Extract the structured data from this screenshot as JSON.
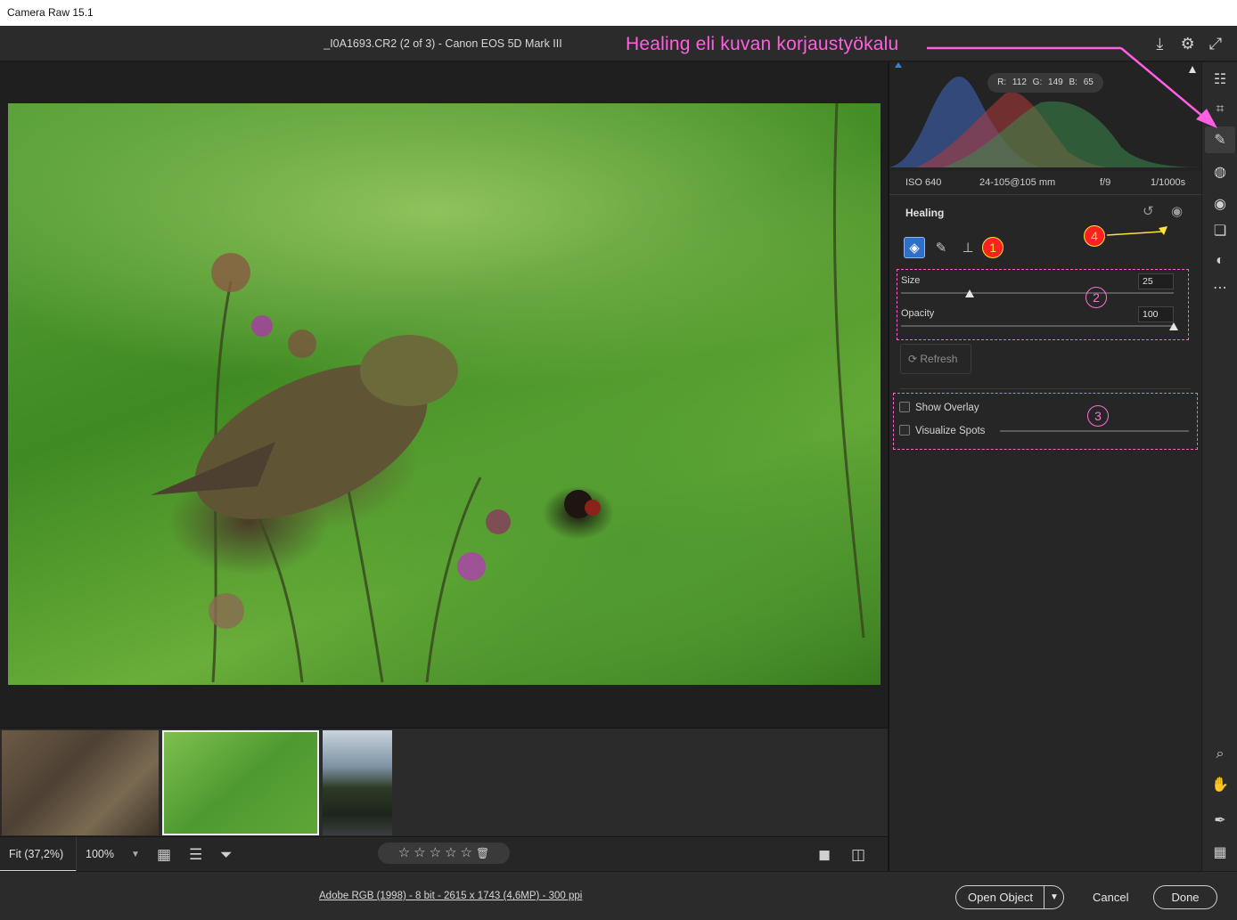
{
  "window": {
    "title": "Camera Raw 15.1"
  },
  "header": {
    "filename": "_I0A1693.CR2 (2 of 3)  -  Canon EOS 5D Mark III"
  },
  "annotation": {
    "callout_text": "Healing eli kuvan korjaustyökalu"
  },
  "histogram": {
    "r": "R: 112",
    "g": "G: 149",
    "b": "B: 65"
  },
  "exif": {
    "iso": "ISO 640",
    "lens": "24-105@105 mm",
    "aperture": "f/9",
    "shutter": "1/1000s"
  },
  "healing": {
    "title": "Healing",
    "size_label": "Size",
    "size_value": "25",
    "size_level": 0.25,
    "opacity_label": "Opacity",
    "opacity_value": "100",
    "opacity_level": 1.0,
    "refresh_label": "Refresh",
    "show_overlay_label": "Show Overlay",
    "visualize_spots_label": "Visualize Spots",
    "badges": [
      "1",
      "2",
      "3",
      "4"
    ]
  },
  "toolbar": {
    "fit_label": "Fit (37,2%)",
    "zoom_label": "100%"
  },
  "footer": {
    "image_info": "Adobe RGB (1998) - 8 bit - 2615 x 1743 (4,6MP) - 300 ppi",
    "open_object": "Open Object",
    "cancel": "Cancel",
    "done": "Done"
  },
  "colors": {
    "accent": "#2f6fc8",
    "annotation": "#ff5fe0",
    "badge_red": "#ff2020",
    "badge_yellow": "#ffe23a"
  },
  "filmstrip": {
    "selected_index": 1
  }
}
